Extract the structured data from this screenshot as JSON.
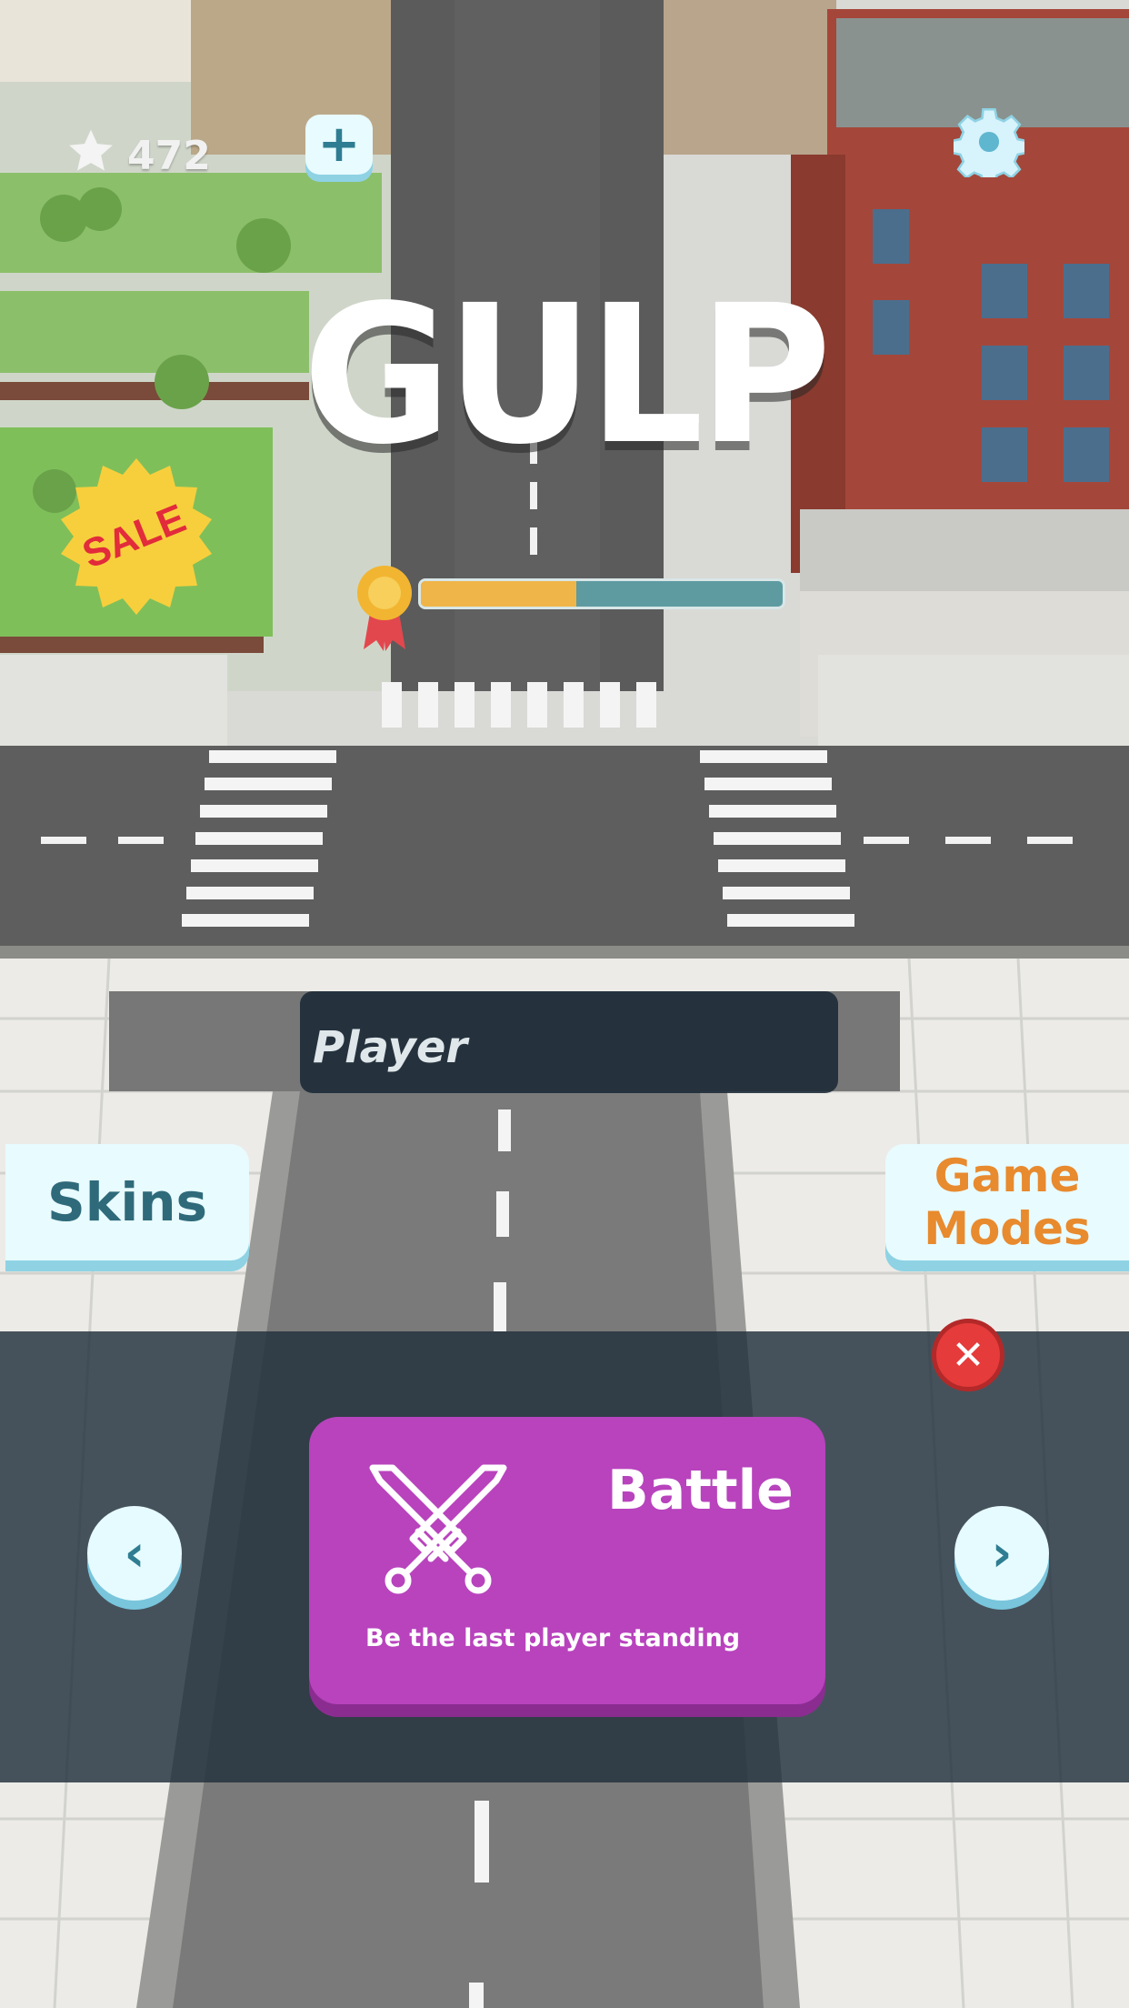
{
  "hud": {
    "coins": "472",
    "plus_symbol": "+"
  },
  "game_title": "GULP",
  "sale_badge": "SALE",
  "progress": {
    "fraction": 0.43
  },
  "player_name": "Player",
  "buttons": {
    "skins": "Skins",
    "game_modes_line1": "Game",
    "game_modes_line2": "Modes",
    "close_symbol": "✕",
    "prev_symbol": "‹",
    "next_symbol": "›"
  },
  "mode_card": {
    "title": "Battle",
    "description": "Be the last player standing"
  },
  "colors": {
    "accent_cyan": "#e8fbff",
    "mode_purple": "#b843bd",
    "progress_fill": "#f0b548",
    "close_red": "#e53b3b",
    "orange_text": "#e88a2e"
  }
}
